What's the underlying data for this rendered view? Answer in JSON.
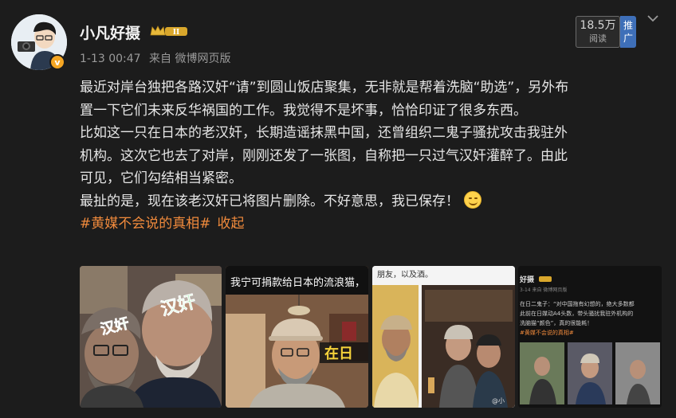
{
  "user": {
    "name": "小凡好摄",
    "verified_mark": "v",
    "vip_level": "II"
  },
  "post_meta": {
    "time": "1-13 00:47",
    "source": "来自 微博网页版"
  },
  "stats": {
    "read_count": "18.5万",
    "read_label": "阅读",
    "promote_label": "推广"
  },
  "content": {
    "lines": [
      "最近对岸台独把各路汉奸“请”到圆山饭店聚集，无非就是帮着洗脑“助选”，另外布",
      "置一下它们未来反华祸国的工作。我觉得不是坏事，恰恰印证了很多东西。",
      "比如这一只在日本的老汉奸，长期造谣抹黑中国，还曾组织二鬼子骚扰攻击我驻外",
      "机构。这次它也去了对岸，刚刚还发了一张图，自称把一只过气汉奸灌醉了。由此",
      "可见，它们勾结相当紧密。",
      "最扯的是，现在该老汉奸已将图片删除。不好意思，我已保存！"
    ],
    "hashtag": "#黄媒不会说的真相#",
    "collapse_label": "收起"
  },
  "images": {
    "img1": {
      "stamp1": "汉奸",
      "stamp2": "汉奸"
    },
    "img2": {
      "banner": "我宁可捐款给日本的流浪猫，",
      "caption": "在日"
    },
    "img3": {
      "caption": "朋友，以及酒。"
    },
    "img4": {
      "name": "好摄",
      "time": "3-14  来自 微博网页版",
      "text_lines": [
        "在日二鬼子：“对中国拖有幻想的，绝大多数都",
        "此前在日媒动A4头数，带头骚扰我驻外机构的",
        "洗脑猫“颜色”，真的很能耗！"
      ],
      "tag": "#黄媒不会说的真相#"
    },
    "watermark": "@小"
  }
}
